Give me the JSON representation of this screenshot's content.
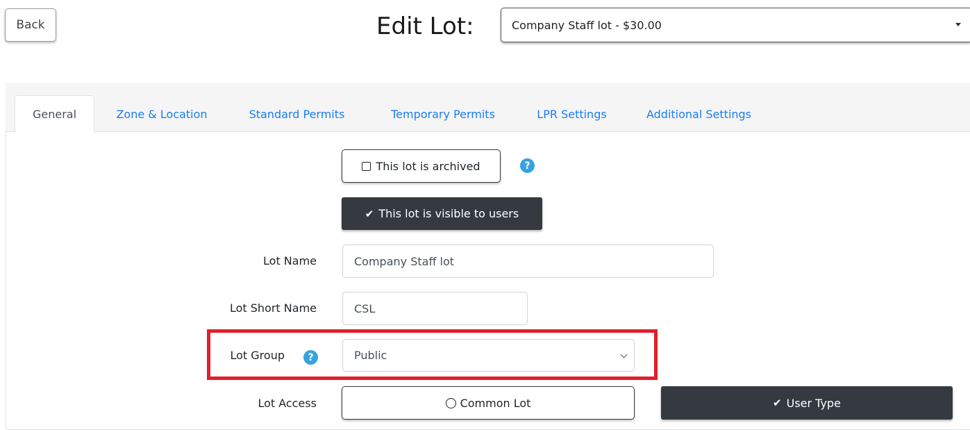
{
  "header": {
    "back_label": "Back",
    "title": "Edit Lot:",
    "lot_selector_value": "Company Staff lot - $30.00"
  },
  "tabs": [
    {
      "label": "General",
      "active": true
    },
    {
      "label": "Zone & Location",
      "active": false
    },
    {
      "label": "Standard Permits",
      "active": false
    },
    {
      "label": "Temporary Permits",
      "active": false
    },
    {
      "label": "LPR Settings",
      "active": false
    },
    {
      "label": "Additional Settings",
      "active": false
    }
  ],
  "general": {
    "archived_toggle": {
      "label": "This lot is archived",
      "checked": false
    },
    "visible_toggle": {
      "label": "This lot is visible to users",
      "checked": true
    },
    "lot_name": {
      "label": "Lot Name",
      "value": "Company Staff lot"
    },
    "lot_short_name": {
      "label": "Lot Short Name",
      "value": "CSL"
    },
    "lot_group": {
      "label": "Lot Group",
      "value": "Public"
    },
    "lot_access": {
      "label": "Lot Access",
      "options": [
        {
          "label": "Common Lot",
          "selected": false
        },
        {
          "label": "User Type",
          "selected": true
        }
      ]
    }
  },
  "icons": {
    "help": "question-circle-icon",
    "check": "check-icon",
    "checkbox": "checkbox-empty-icon",
    "radio": "radio-empty-icon"
  },
  "colors": {
    "tab_link": "#1a7cf5",
    "dark_button": "#343a40",
    "help_icon": "#36a3e0",
    "highlight": "#e0202a"
  }
}
